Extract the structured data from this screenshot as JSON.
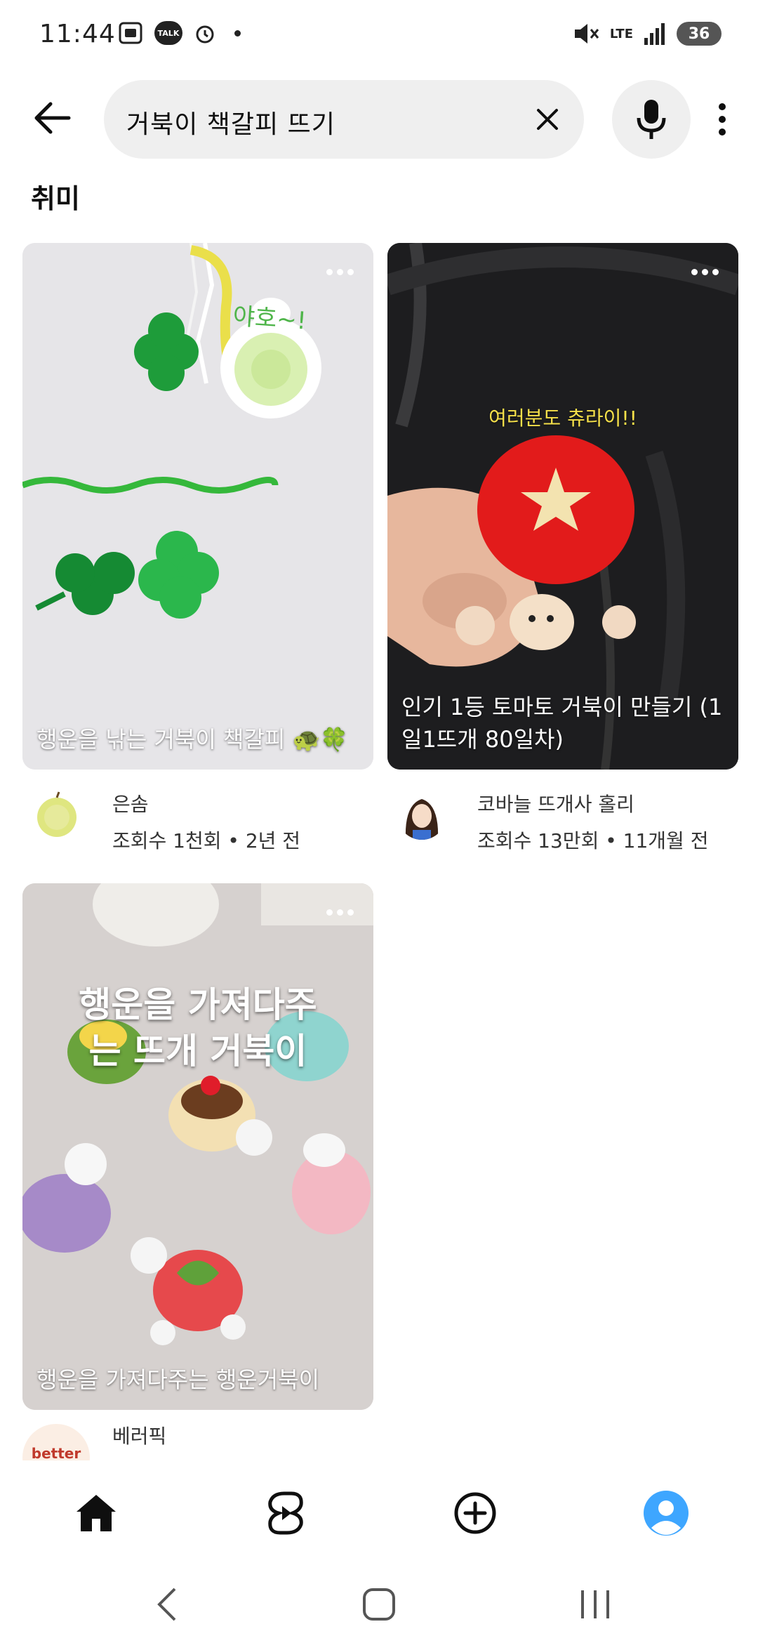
{
  "status_bar": {
    "time": "11:44",
    "left_icons": [
      "gallery-icon",
      "talk-icon",
      "alarm-icon",
      "dot-icon"
    ],
    "talk_badge": "TALK",
    "network": "LTE",
    "battery": "36"
  },
  "search": {
    "query": "거북이 책갈피 뜨기"
  },
  "section": {
    "title": "취미"
  },
  "videos": [
    {
      "overlay_title": "행운을 낚는 거북이 책갈피 🐢🍀",
      "image_text": "야호~!",
      "channel": "은솜",
      "stats": "조회수 1천회 • 2년 전"
    },
    {
      "overlay_title": "인기 1등 토마토 거북이 만들기 (1일1뜨개 80일차)",
      "image_text": "여러분도 츄라이!!",
      "channel": "코바늘 뜨개사 홀리",
      "stats": "조회수 13만회 • 11개월 전"
    },
    {
      "overlay_title": "행운을 가져다주는 행운거북이",
      "image_text": "행운을 가져다주는 뜨개 거북이",
      "channel": "베러픽",
      "avatar_text": "better"
    }
  ],
  "bottom_nav": [
    "home-icon",
    "shorts-icon",
    "create-icon",
    "account-icon"
  ],
  "colors": {
    "search_bg": "#efefef",
    "text_primary": "#0f0f0f",
    "caption_yellow": "#f5e04a",
    "account_blue": "#3ea6ff"
  }
}
